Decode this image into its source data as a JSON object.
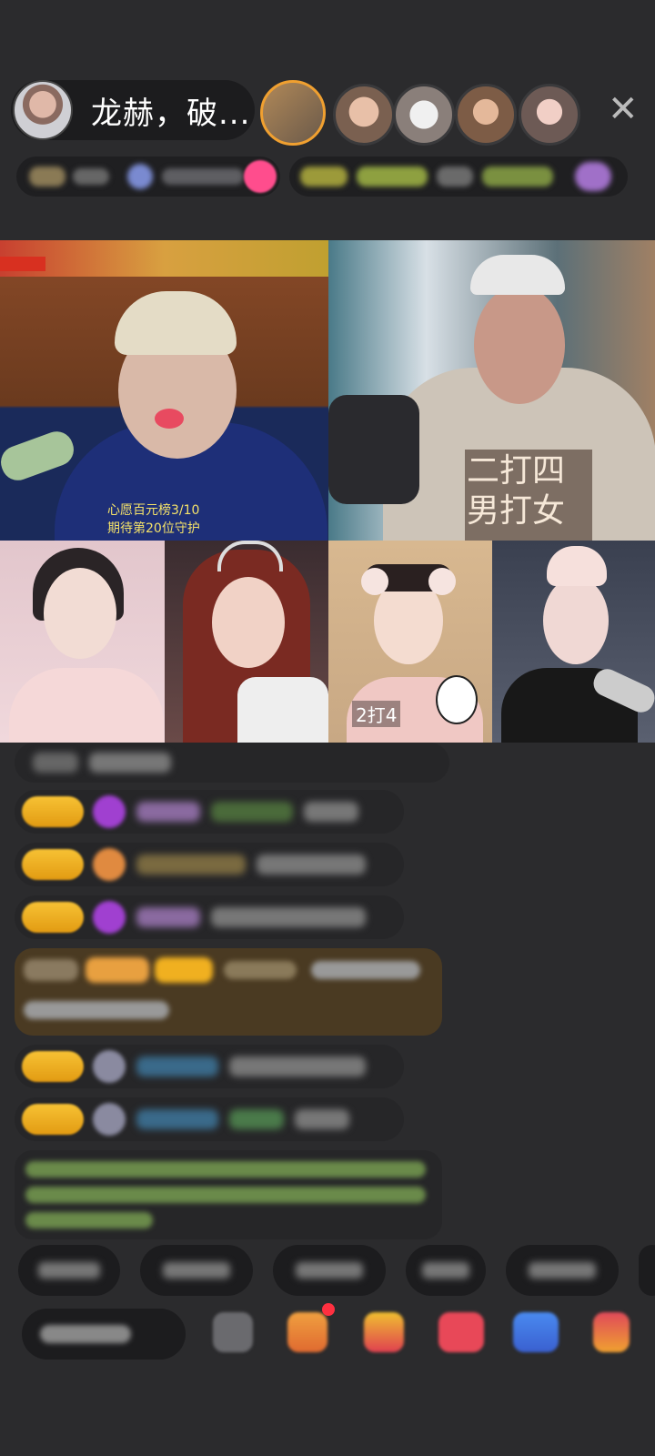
{
  "header": {
    "host_name": "龙赫，破..."
  },
  "stream": {
    "tile1_rank_line1": "心愿百元榜3/10",
    "tile1_rank_line2": "期待第20位守护",
    "tile2_caption_line1": "二打四",
    "tile2_caption_line2": "男打女",
    "tile3_label": "2打4"
  },
  "colors": {
    "background": "#2b2b2d",
    "level_badge": "#f0b020",
    "accent_pink": "#ff4d8d",
    "accent_gold": "#f0a030"
  },
  "icons": {
    "close": "close-icon"
  }
}
